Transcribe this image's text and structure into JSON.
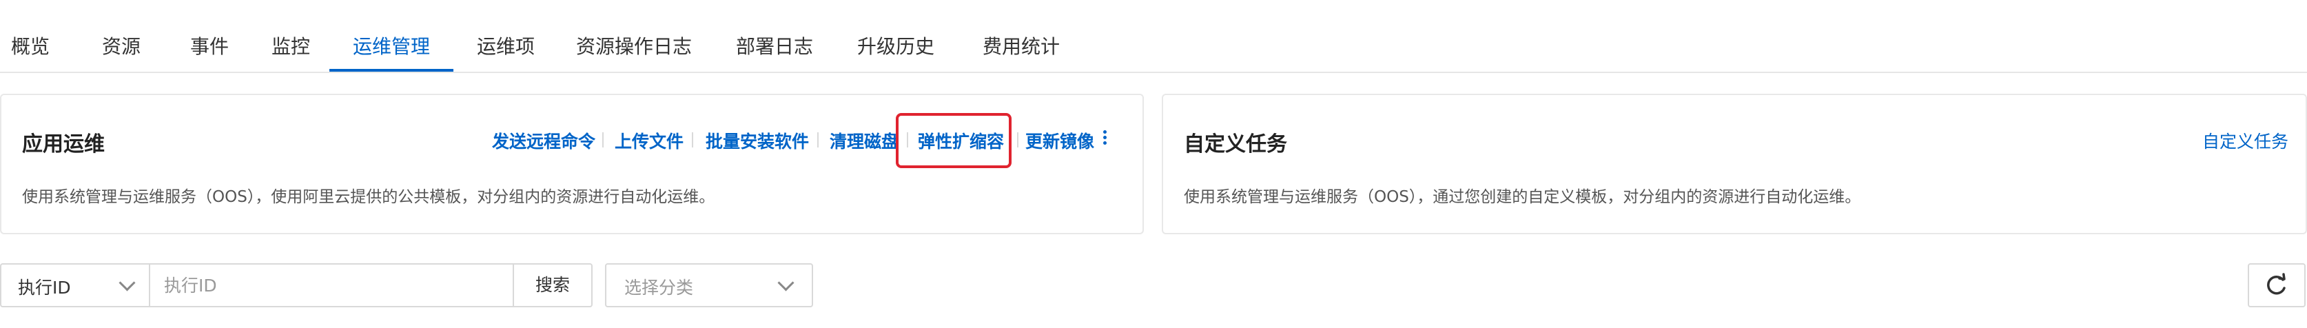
{
  "tabs": [
    "概览",
    "资源",
    "事件",
    "监控",
    "运维管理",
    "运维项",
    "资源操作日志",
    "部署日志",
    "升级历史",
    "费用统计"
  ],
  "active_tab": "运维管理",
  "app_ops": {
    "title": "应用运维",
    "actions": [
      "发送远程命令",
      "上传文件",
      "批量安装软件",
      "清理磁盘",
      "弹性扩缩容",
      "更新镜像"
    ],
    "highlighted_action": "弹性扩缩容",
    "description": "使用系统管理与运维服务（OOS），使用阿里云提供的公共模板，对分组内的资源进行自动化运维。"
  },
  "custom_task": {
    "title": "自定义任务",
    "action": "自定义任务",
    "description": "使用系统管理与运维服务（OOS），通过您创建的自定义模板，对分组内的资源进行自动化运维。"
  },
  "filter": {
    "type_value": "执行ID",
    "input_placeholder": "执行ID",
    "search_label": "搜索",
    "category_placeholder": "选择分类"
  },
  "colors": {
    "accent": "#0064c8",
    "highlight": "#e0232f"
  },
  "icons": {
    "more": "more-vertical-icon",
    "chevron": "chevron-down-icon",
    "refresh": "refresh-icon"
  }
}
